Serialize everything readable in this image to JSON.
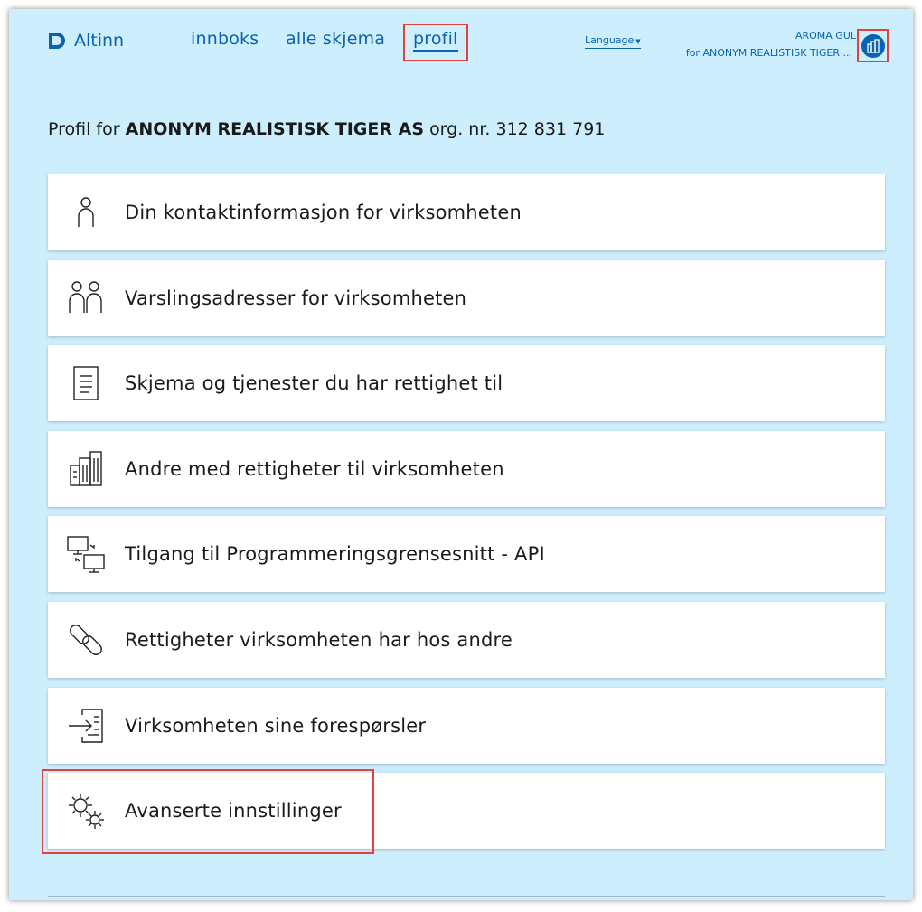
{
  "header": {
    "logo_text": "Altinn",
    "nav": [
      {
        "label": "innboks"
      },
      {
        "label": "alle skjema"
      },
      {
        "label": "profil"
      }
    ],
    "language_label": "Language",
    "user_name": "AROMA GUL",
    "user_org": "for ANONYM REALISTISK TIGER ..."
  },
  "profile": {
    "prefix": "Profil for",
    "org_name": "ANONYM REALISTISK TIGER AS",
    "suffix": "org. nr. 312 831 791"
  },
  "menu": {
    "items": [
      {
        "label": "Din kontaktinformasjon for virksomheten",
        "icon": "person-icon"
      },
      {
        "label": "Varslingsadresser for virksomheten",
        "icon": "people-icon"
      },
      {
        "label": "Skjema og tjenester du har rettighet til",
        "icon": "document-icon"
      },
      {
        "label": "Andre med rettigheter til virksomheten",
        "icon": "building-icon"
      },
      {
        "label": "Tilgang til Programmeringsgrensesnitt - API",
        "icon": "computers-icon"
      },
      {
        "label": "Rettigheter virksomheten har hos andre",
        "icon": "link-icon"
      },
      {
        "label": "Virksomheten sine forespørsler",
        "icon": "request-icon"
      },
      {
        "label": "Avanserte innstillinger",
        "icon": "gears-icon"
      }
    ]
  },
  "colors": {
    "background": "#cdeefc",
    "accent": "#0a62b3",
    "highlight": "#e2403b"
  }
}
